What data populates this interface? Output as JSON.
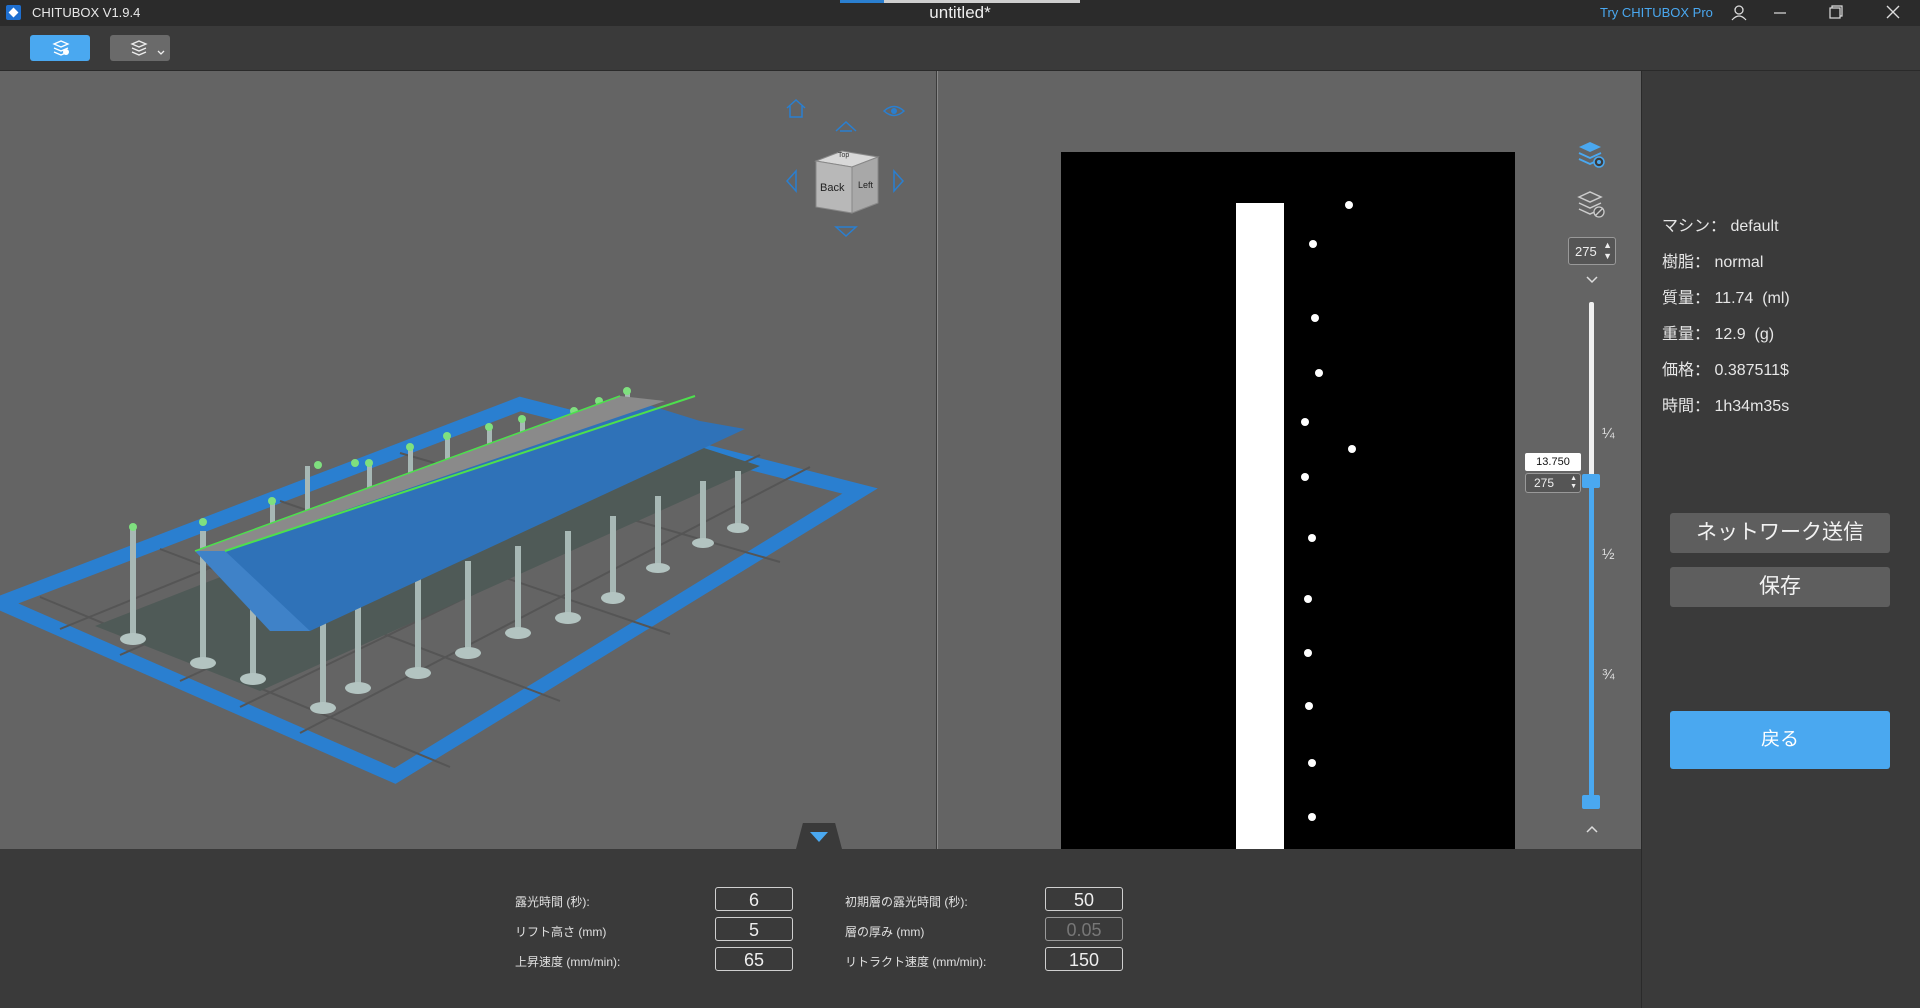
{
  "titlebar": {
    "app_name": "CHITUBOX V1.9.4",
    "document_title": "untitled*",
    "try_pro_label": "Try CHITUBOX Pro"
  },
  "nav_cube": {
    "back_label": "Back",
    "left_label": "Left",
    "top_label": "Top"
  },
  "layer_slider": {
    "top_layer_value": "275",
    "current_height": "13.750",
    "current_layer": "275",
    "tick_quarter": "¼",
    "tick_half": "½",
    "tick_three_quarter": "¾"
  },
  "info": {
    "machine": {
      "label": "マシン：",
      "value": "default"
    },
    "resin": {
      "label": "樹脂：",
      "value": "normal"
    },
    "volume": {
      "label": "質量：",
      "value": "11.74  (ml)"
    },
    "weight": {
      "label": "重量：",
      "value": "12.9  (g)"
    },
    "price": {
      "label": "価格：",
      "value": "0.387511$"
    },
    "time": {
      "label": "時間：",
      "value": "1h34m35s"
    }
  },
  "buttons": {
    "network_send": "ネットワーク送信",
    "save": "保存",
    "back": "戻る"
  },
  "params": {
    "exposure_time": {
      "label": "露光時間 (秒):",
      "value": "6"
    },
    "lift_height": {
      "label": "リフト高さ (mm)",
      "value": "5"
    },
    "lift_speed": {
      "label": "上昇速度 (mm/min):",
      "value": "65"
    },
    "bottom_exposure": {
      "label": "初期層の露光時間 (秒):",
      "value": "50"
    },
    "layer_height": {
      "label": "層の厚み (mm)",
      "value": "0.05"
    },
    "retract_speed": {
      "label": "リトラクト速度 (mm/min):",
      "value": "150"
    }
  },
  "colors": {
    "accent": "#4aa8f0",
    "model_blue": "#2f72b8",
    "platform_blue": "#2a7fd0"
  }
}
